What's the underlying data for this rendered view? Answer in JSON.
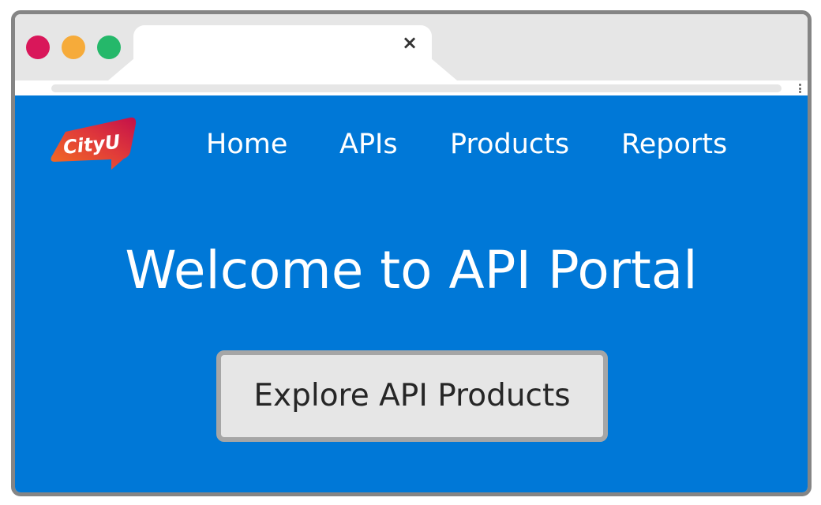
{
  "browser": {
    "tab": {
      "title": "",
      "close_glyph": "×"
    },
    "address_bar": {
      "url": ""
    },
    "window_controls": [
      "close",
      "minimize",
      "maximize"
    ]
  },
  "site": {
    "logo_text": "CityU",
    "nav": [
      {
        "label": "Home"
      },
      {
        "label": "APIs"
      },
      {
        "label": "Products"
      },
      {
        "label": "Reports"
      }
    ],
    "hero": {
      "title": "Welcome to API Portal",
      "cta_label": "Explore API Products"
    }
  },
  "colors": {
    "page_background": "#0078d7",
    "chrome_background": "#e6e6e6",
    "window_border": "#858585",
    "close_light": "#d9175a",
    "minimize_light": "#f6ab3a",
    "maximize_light": "#25b86a",
    "button_background": "#e6e6e6",
    "button_border": "#a6a6a6",
    "logo_gradient_start": "#f37021",
    "logo_gradient_end": "#c4104a"
  },
  "icons": {
    "tab_close": "close-icon",
    "browser_menu": "kebab-menu-icon"
  }
}
